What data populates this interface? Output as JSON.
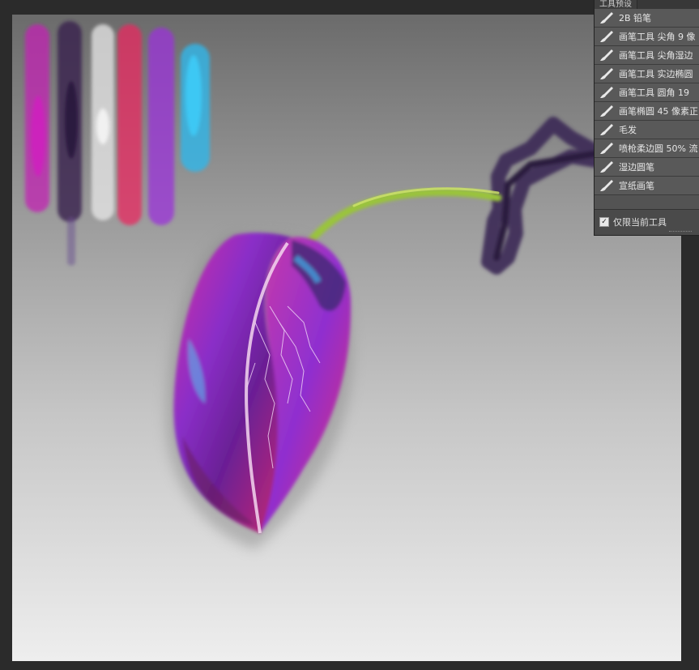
{
  "panel": {
    "title": "工具预设",
    "presets": [
      {
        "label": "2B 铅笔",
        "icon": "brush-icon"
      },
      {
        "label": "画笔工具 尖角 9 像",
        "icon": "brush-icon"
      },
      {
        "label": "画笔工具 尖角湿边",
        "icon": "brush-icon"
      },
      {
        "label": "画笔工具 实边椭圆",
        "icon": "brush-icon"
      },
      {
        "label": "画笔工具 圆角 19 ",
        "icon": "brush-icon"
      },
      {
        "label": "画笔椭圆 45 像素正",
        "icon": "brush-icon"
      },
      {
        "label": "毛发",
        "icon": "brush-icon"
      },
      {
        "label": "喷枪柔边圆 50% 流",
        "icon": "brush-icon"
      },
      {
        "label": "湿边圆笔",
        "icon": "brush-icon"
      },
      {
        "label": "宣纸画笔",
        "icon": "brush-icon"
      }
    ],
    "footer": {
      "checkbox_label": "仅限当前工具",
      "checked": true,
      "check_glyph": "✓"
    }
  },
  "swatches": [
    "#c21fb3",
    "#3a1f4d",
    "#e8e8e8",
    "#e8285f",
    "#9b33d9",
    "#2fb6ea"
  ],
  "colors": {
    "canvas_top": "#6b6b6b",
    "canvas_bottom": "#eeeeee",
    "panel_bg": "#595959",
    "stem": "#9ac43a",
    "branch": "#3b2a55"
  }
}
